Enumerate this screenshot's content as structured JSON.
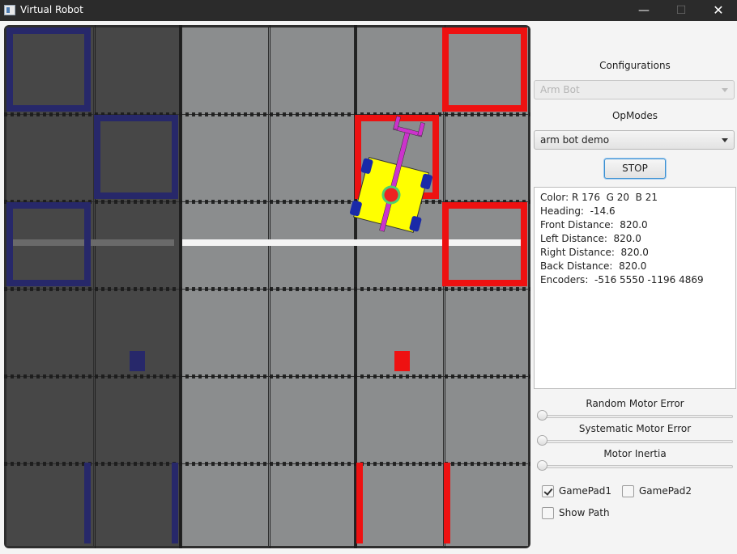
{
  "window": {
    "title": "Virtual Robot",
    "controls": {
      "minimize_glyph": "—",
      "maximize_glyph": "☐",
      "close_glyph": "✕"
    }
  },
  "panel": {
    "configurations_label": "Configurations",
    "configuration_value": "Arm Bot",
    "opmodes_label": "OpModes",
    "opmode_value": "arm bot demo",
    "stop_label": "STOP",
    "telemetry": [
      "Color: R 176  G 20  B 21",
      "Heading:  -14.6",
      "Front Distance:  820.0",
      "Left Distance:  820.0",
      "Right Distance:  820.0",
      "Back Distance:  820.0",
      "Encoders:  -516 5550 -1196 4869"
    ],
    "random_motor_error_label": "Random Motor Error",
    "random_motor_error_value": 0,
    "systematic_motor_error_label": "Systematic Motor Error",
    "systematic_motor_error_value": 0,
    "motor_inertia_label": "Motor Inertia",
    "motor_inertia_value": 0,
    "gamepad1_label": "GamePad1",
    "gamepad1_checked": true,
    "gamepad2_label": "GamePad2",
    "gamepad2_checked": false,
    "show_path_label": "Show Path",
    "show_path_checked": false
  },
  "field": {
    "colors": {
      "tile_dark": "#474747",
      "tile_light": "#8b8d8e",
      "blue_zone": "#27286a",
      "red_zone": "#ee1111",
      "tape_white": "#f4f4f4",
      "robot_body": "#ffff00",
      "robot_arm": "#cc33cc",
      "wheel": "#1a2aa8"
    },
    "robot_heading_deg": -14.6,
    "tile_grid": "6x6"
  }
}
